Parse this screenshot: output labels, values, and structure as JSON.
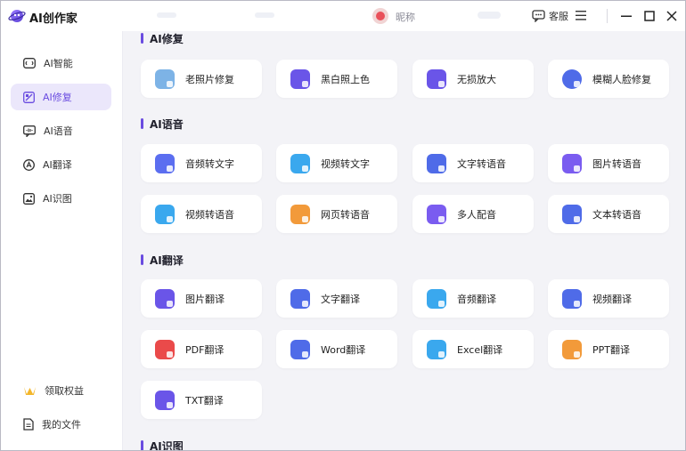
{
  "app": {
    "title": "AI创作家",
    "nickname": "昵称",
    "service_label": "客服"
  },
  "colors": {
    "accent": "#6a4ce0",
    "active_bg": "#ebe7fb"
  },
  "sidebar": {
    "items": [
      {
        "label": "AI智能",
        "icon": "ai-chat-icon"
      },
      {
        "label": "AI修复",
        "icon": "image-edit-icon",
        "active": true
      },
      {
        "label": "AI语音",
        "icon": "voice-message-icon"
      },
      {
        "label": "AI翻译",
        "icon": "translate-icon"
      },
      {
        "label": "AI识图",
        "icon": "image-recognition-icon"
      }
    ],
    "bottom": [
      {
        "label": "领取权益",
        "icon": "vip-crown-icon"
      },
      {
        "label": "我的文件",
        "icon": "file-icon"
      }
    ]
  },
  "sections": [
    {
      "title": "AI修复",
      "cards": [
        {
          "label": "老照片修复",
          "icon": "old-photo-icon",
          "color": "#7db3e6"
        },
        {
          "label": "黑白照上色",
          "icon": "colorize-icon",
          "color": "#6a55e8"
        },
        {
          "label": "无损放大",
          "icon": "upscale-icon",
          "color": "#6a55e8"
        },
        {
          "label": "模糊人脸修复",
          "icon": "face-restore-icon",
          "color": "#4f6be8"
        }
      ]
    },
    {
      "title": "AI语音",
      "cards": [
        {
          "label": "音频转文字",
          "icon": "audio-to-text-icon",
          "color": "#5b6ef0"
        },
        {
          "label": "视频转文字",
          "icon": "video-to-text-icon",
          "color": "#3aa8ee"
        },
        {
          "label": "文字转语音",
          "icon": "text-to-speech-icon",
          "color": "#4f6be8"
        },
        {
          "label": "图片转语音",
          "icon": "image-to-speech-icon",
          "color": "#7a5cf0"
        },
        {
          "label": "视频转语音",
          "icon": "video-to-speech-icon",
          "color": "#3aa8ee"
        },
        {
          "label": "网页转语音",
          "icon": "webpage-to-speech-icon",
          "color": "#f29a3a"
        },
        {
          "label": "多人配音",
          "icon": "multi-voice-icon",
          "color": "#7a5cf0"
        },
        {
          "label": "文本转语音",
          "icon": "document-to-speech-icon",
          "color": "#4f6be8"
        }
      ]
    },
    {
      "title": "AI翻译",
      "cards": [
        {
          "label": "图片翻译",
          "icon": "image-translate-icon",
          "color": "#6a55e8"
        },
        {
          "label": "文字翻译",
          "icon": "text-translate-icon",
          "color": "#4f6be8"
        },
        {
          "label": "音频翻译",
          "icon": "audio-translate-icon",
          "color": "#3aa8ee"
        },
        {
          "label": "视频翻译",
          "icon": "video-translate-icon",
          "color": "#4f6be8"
        },
        {
          "label": "PDF翻译",
          "icon": "pdf-translate-icon",
          "color": "#ea4a4a"
        },
        {
          "label": "Word翻译",
          "icon": "word-translate-icon",
          "color": "#4f6be8"
        },
        {
          "label": "Excel翻译",
          "icon": "excel-translate-icon",
          "color": "#3aa8ee"
        },
        {
          "label": "PPT翻译",
          "icon": "ppt-translate-icon",
          "color": "#f29a3a"
        },
        {
          "label": "TXT翻译",
          "icon": "txt-translate-icon",
          "color": "#6a55e8"
        }
      ]
    },
    {
      "title": "AI识图",
      "cards": []
    }
  ]
}
